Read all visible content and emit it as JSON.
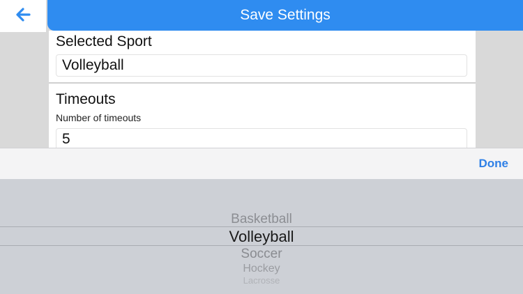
{
  "header": {
    "title": "Save Settings",
    "back_icon": "arrow-left-icon",
    "accent_color": "#2f8cf0"
  },
  "form": {
    "sport": {
      "title": "Selected Sport",
      "value": "Volleyball"
    },
    "timeouts": {
      "title": "Timeouts",
      "label": "Number of timeouts",
      "value": "5"
    }
  },
  "toolbar": {
    "done_label": "Done"
  },
  "picker": {
    "options": [
      "Basketball",
      "Volleyball",
      "Soccer",
      "Hockey",
      "Lacrosse"
    ],
    "selected": "Volleyball"
  }
}
